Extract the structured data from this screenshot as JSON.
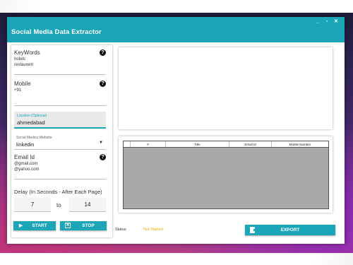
{
  "window": {
    "title": "Social Media Data Extractor",
    "controls": {
      "minimize": "_",
      "maximize": "▫",
      "close": "✕"
    }
  },
  "form": {
    "keywords": {
      "label": "KeyWords",
      "lines": [
        "hotels",
        "restaurent"
      ]
    },
    "mobile": {
      "label": "Mobile",
      "value": "+91"
    },
    "location": {
      "label": "Location (Optional)",
      "value": "ahmedabad"
    },
    "website": {
      "label": "Social Medica Website",
      "selected": "linkedin"
    },
    "email": {
      "label": "Email Id",
      "lines": [
        "@gmail.com",
        "@yahoo.com"
      ]
    },
    "delay": {
      "label": "Delay (In Seconds - After Each Page)",
      "from": "7",
      "to_label": "to",
      "to": "14"
    },
    "help_glyph": "?"
  },
  "buttons": {
    "start": "START",
    "stop": "STOP",
    "export": "EXPORT"
  },
  "table": {
    "columns": [
      "#",
      "Title",
      "Email Id",
      "Mobile Number"
    ]
  },
  "status": {
    "label": "Status",
    "value": "Not Started",
    "value_color": "#f0a500"
  },
  "colors": {
    "accent": "#1aa6b7"
  }
}
